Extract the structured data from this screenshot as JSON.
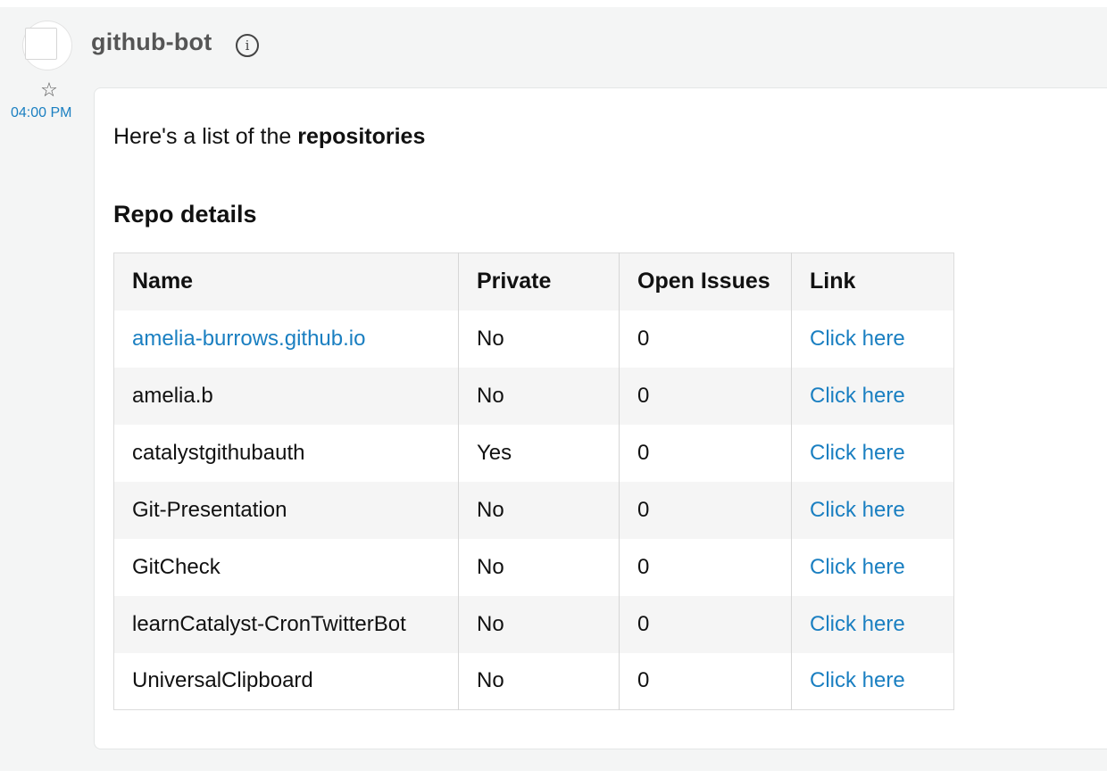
{
  "message": {
    "sender": "github-bot",
    "time": "04:00 PM",
    "intro_prefix": "Here's a list of the ",
    "intro_bold": "repositories",
    "section_title": "Repo details"
  },
  "table": {
    "headers": {
      "name": "Name",
      "private": "Private",
      "open_issues": "Open Issues",
      "link": "Link"
    },
    "rows": [
      {
        "name": "amelia-burrows.github.io",
        "private": "No",
        "open_issues": "0",
        "link": "Click here"
      },
      {
        "name": "amelia.b",
        "private": "No",
        "open_issues": "0",
        "link": "Click here"
      },
      {
        "name": "catalystgithubauth",
        "private": "Yes",
        "open_issues": "0",
        "link": "Click here"
      },
      {
        "name": "Git-Presentation",
        "private": "No",
        "open_issues": "0",
        "link": "Click here"
      },
      {
        "name": "GitCheck",
        "private": "No",
        "open_issues": "0",
        "link": "Click here"
      },
      {
        "name": "learnCatalyst-CronTwitterBot",
        "private": "No",
        "open_issues": "0",
        "link": "Click here"
      },
      {
        "name": "UniversalClipboard",
        "private": "No",
        "open_issues": "0",
        "link": "Click here"
      }
    ]
  },
  "colors": {
    "link": "#1a7fc1",
    "background": "#f4f5f5",
    "sender": "#555555"
  },
  "icons": {
    "info": "info-icon",
    "star": "star-icon"
  }
}
